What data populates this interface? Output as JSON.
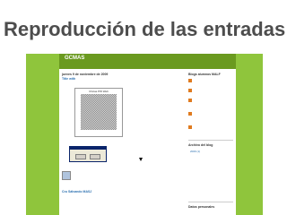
{
  "slide": {
    "title": "Reproducción de las entradas"
  },
  "colors": {
    "frame_green": "#8fc53c",
    "header_green": "#6a9a1f",
    "link_blue": "#2a6fb0"
  },
  "blog": {
    "title": "GCMAS",
    "description": "",
    "post": {
      "date": "jueves 9 de noviembre de 2009",
      "title": "Title with",
      "image_title": "Chicas PW Web",
      "next_title": "Cru Sálvando MASJ"
    },
    "sidebar": {
      "followers_heading": "Blogs alumnos MALF",
      "archive_heading": "Archivo del blog",
      "archive_year": "2009 (1)",
      "more_heading": "Datos personales"
    }
  }
}
